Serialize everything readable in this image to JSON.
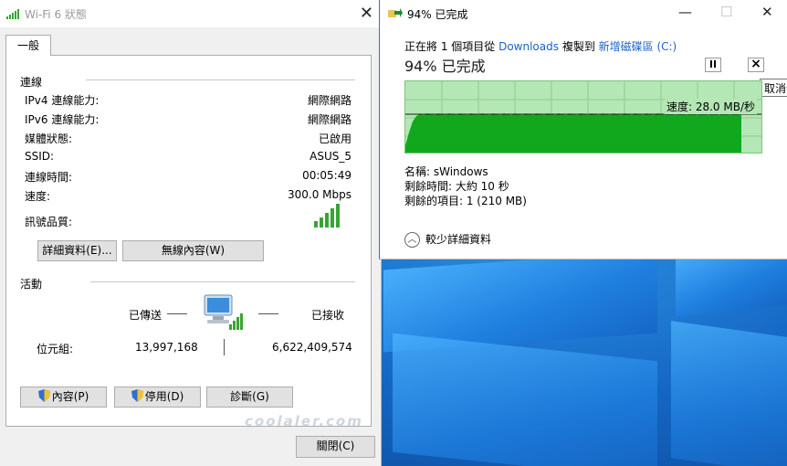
{
  "wifi_window": {
    "title": "Wi-Fi 6 狀態",
    "tab": "一般",
    "connection_group": "連線",
    "rows": [
      {
        "label": "IPv4 連線能力:",
        "value": "網際網路"
      },
      {
        "label": "IPv6 連線能力:",
        "value": "網際網路"
      },
      {
        "label": "媒體狀態:",
        "value": "已啟用"
      },
      {
        "label": "SSID:",
        "value": "ASUS_5"
      },
      {
        "label": "連線時間:",
        "value": "00:05:49"
      },
      {
        "label": "速度:",
        "value": "300.0 Mbps"
      }
    ],
    "signal_label": "訊號品質:",
    "details_button": "詳細資料(E)...",
    "wireless_props_button": "無線內容(W)",
    "activity_group": "活動",
    "sent_label": "已傳送",
    "received_label": "已接收",
    "bytes_label": "位元組:",
    "bytes_sent": "13,997,168",
    "bytes_received": "6,622,409,574",
    "properties_button": "內容(P)",
    "disable_button": "停用(D)",
    "diagnose_button": "診斷(G)",
    "close_button": "關閉(C)"
  },
  "copy_window": {
    "title": "94% 已完成",
    "from_prefix": "正在將 1 個項目從 ",
    "from_source": "Downloads",
    "from_mid": " 複製到 ",
    "from_dest": "新增磁碟區 (C:)",
    "progress_text": "94% 已完成",
    "progress_percent": 94,
    "pause_label": "II",
    "cancel_label": "×",
    "cancel_tooltip": "取消作",
    "speed": "速度: 28.0 MB/秒",
    "name": "名稱: sWindows",
    "time_left": "剩餘時間: 大約 10 秒",
    "items_left": "剩餘的項目: 1 (210 MB)",
    "less_details": "較少詳細資料"
  },
  "watermark": "coolaler.com",
  "colors": {
    "accent_link": "#1a63c7",
    "graph_fill": "#12a81e",
    "graph_bg": "#b5e6b5",
    "signal": "#3aa335"
  }
}
